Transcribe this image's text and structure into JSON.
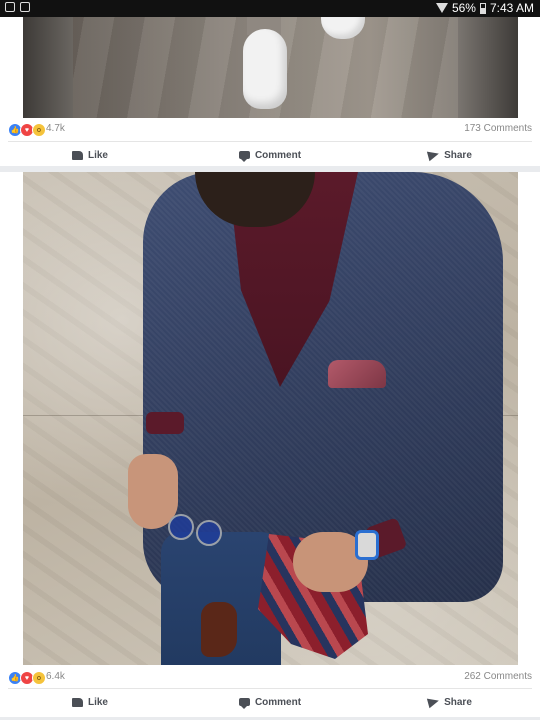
{
  "status_bar": {
    "battery": "56%",
    "time": "7:43 AM",
    "icons": [
      "gallery-icon",
      "photo-icon",
      "wifi-icon",
      "battery-icon"
    ]
  },
  "posts": [
    {
      "reaction_count": "4.7k",
      "comments": "173 Comments",
      "reactions": [
        "like",
        "love",
        "wow"
      ],
      "actions": {
        "like": "Like",
        "comment": "Comment",
        "share": "Share"
      }
    },
    {
      "reaction_count": "6.4k",
      "comments": "262 Comments",
      "reactions": [
        "like",
        "love",
        "wow"
      ],
      "actions": {
        "like": "Like",
        "comment": "Comment",
        "share": "Share"
      }
    }
  ],
  "colors": {
    "like": "#3b82f6",
    "love": "#ef4444",
    "wow": "#f5c33b",
    "action_text": "#4b4f56",
    "background": "#e9ebee"
  }
}
